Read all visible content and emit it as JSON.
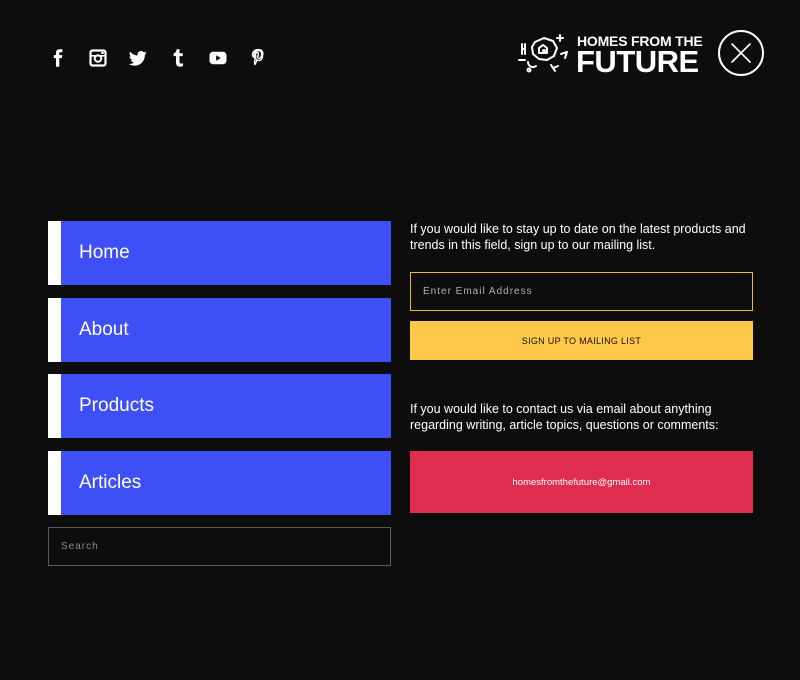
{
  "social": {
    "icons": [
      "facebook-icon",
      "instagram-icon",
      "twitter-icon",
      "tumblr-icon",
      "youtube-icon",
      "pinterest-icon"
    ]
  },
  "logo": {
    "top_line": "HOMES FROM THE",
    "bottom_line": "FUTURE"
  },
  "close": {
    "icon": "close-icon"
  },
  "nav": {
    "items": [
      {
        "label": "Home"
      },
      {
        "label": "About"
      },
      {
        "label": "Products"
      },
      {
        "label": "Articles"
      }
    ]
  },
  "search": {
    "placeholder": "Search"
  },
  "newsletter": {
    "intro": "If you would like to stay up to date on the latest products and trends in this field, sign up to our mailing list.",
    "email_placeholder": "Enter Email Address",
    "button_label": "SIGN UP TO MAILING LIST"
  },
  "contact": {
    "intro": "If you would like to contact us via email about anything regarding writing, article topics, questions or comments:",
    "email": "homesfromthefuture@gmail.com"
  },
  "colors": {
    "background": "#0d0d0d",
    "nav_blue": "#3e4ff6",
    "accent_yellow": "#fec94a",
    "accent_red": "#de2d4e"
  }
}
